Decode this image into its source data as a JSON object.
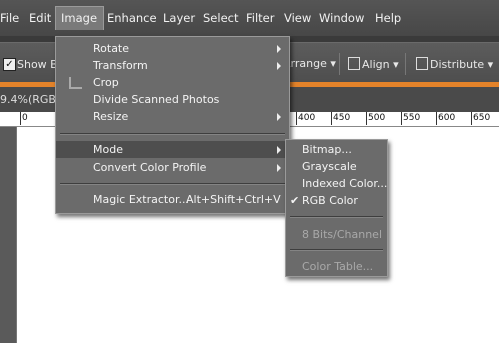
{
  "menubar": {
    "items": [
      "File",
      "Edit",
      "Image",
      "Enhance",
      "Layer",
      "Select",
      "Filter",
      "View",
      "Window",
      "Help"
    ]
  },
  "optionsbar": {
    "show_bounding": "Show Bo",
    "arrange": "Arrange",
    "align": "Align",
    "distribute": "Distribute"
  },
  "document": {
    "tab_label": "9.4%(RGB/"
  },
  "ruler": {
    "labels": [
      "0",
      "400",
      "450",
      "500",
      "550",
      "600",
      "650"
    ]
  },
  "image_menu": {
    "items": [
      {
        "label": "Rotate"
      },
      {
        "label": "Transform"
      },
      {
        "label": "Crop"
      },
      {
        "label": "Divide Scanned Photos"
      },
      {
        "label": "Resize"
      },
      {
        "label": "Mode"
      },
      {
        "label": "Convert Color Profile"
      },
      {
        "label": "Magic Extractor...",
        "shortcut": "Alt+Shift+Ctrl+V"
      }
    ]
  },
  "mode_submenu": {
    "items": [
      {
        "label": "Bitmap..."
      },
      {
        "label": "Grayscale"
      },
      {
        "label": "Indexed Color..."
      },
      {
        "label": "RGB Color",
        "checked": true
      },
      {
        "label": "8 Bits/Channel",
        "disabled": true
      },
      {
        "label": "Color Table...",
        "disabled": true
      }
    ]
  }
}
